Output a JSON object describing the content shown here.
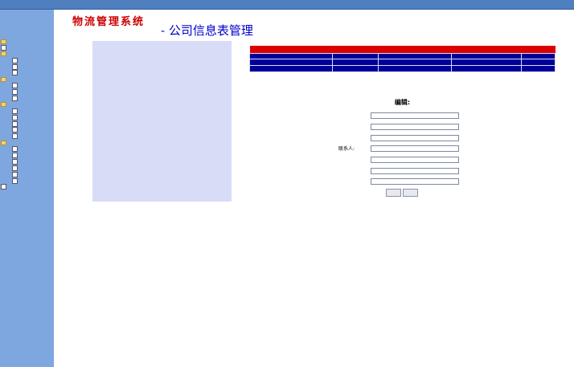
{
  "header": {
    "title": ""
  },
  "sidebar": {
    "date": "",
    "user": "",
    "items": [
      {
        "label": "",
        "level": 0,
        "icon": "folder-icon"
      },
      {
        "label": "",
        "level": 0,
        "icon": "document-icon"
      },
      {
        "label": "",
        "level": 0,
        "icon": "folder-icon"
      },
      {
        "label": "",
        "level": 1,
        "icon": "document-icon"
      },
      {
        "label": "",
        "level": 1,
        "icon": "document-icon"
      },
      {
        "label": "",
        "level": 1,
        "icon": "document-icon",
        "selected": true
      },
      {
        "label": "",
        "level": 0,
        "icon": "folder-icon"
      },
      {
        "label": "",
        "level": 1,
        "icon": "document-icon"
      },
      {
        "label": "",
        "level": 1,
        "icon": "document-icon"
      },
      {
        "label": "",
        "level": 1,
        "icon": "document-icon"
      },
      {
        "label": "",
        "level": 0,
        "icon": "folder-icon"
      },
      {
        "label": "",
        "level": 1,
        "icon": "document-icon"
      },
      {
        "label": "",
        "level": 1,
        "icon": "document-icon"
      },
      {
        "label": "",
        "level": 1,
        "icon": "document-icon"
      },
      {
        "label": "",
        "level": 1,
        "icon": "document-icon"
      },
      {
        "label": "",
        "level": 1,
        "icon": "document-icon"
      },
      {
        "label": "",
        "level": 0,
        "icon": "folder-icon"
      },
      {
        "label": "",
        "level": 1,
        "icon": "document-icon"
      },
      {
        "label": "",
        "level": 1,
        "icon": "document-icon"
      },
      {
        "label": "",
        "level": 1,
        "icon": "document-icon"
      },
      {
        "label": "",
        "level": 1,
        "icon": "document-icon"
      },
      {
        "label": "",
        "level": 1,
        "icon": "document-icon"
      },
      {
        "label": "",
        "level": 1,
        "icon": "document-icon"
      },
      {
        "label": "",
        "level": 0,
        "icon": "document-icon"
      }
    ]
  },
  "brand": "物流管理系统",
  "page_title": "- 公司信息表管理",
  "table": {
    "caption": "",
    "headers": [
      "",
      "",
      "",
      "",
      ""
    ],
    "rows": [
      [
        "",
        "",
        "",
        "",
        ""
      ],
      [
        "",
        "",
        "",
        "",
        ""
      ]
    ]
  },
  "pagination": "",
  "edit": {
    "title": "编辑:",
    "fields": [
      {
        "label": "",
        "value": "",
        "hint": ""
      },
      {
        "label": "",
        "value": "",
        "hint": ""
      },
      {
        "label": "",
        "value": "",
        "hint": ""
      },
      {
        "label": "联系人:",
        "value": "",
        "hint": ""
      },
      {
        "label": "",
        "value": "",
        "hint": ""
      },
      {
        "label": "",
        "value": "",
        "hint": ""
      },
      {
        "label": "",
        "value": "",
        "hint": ""
      }
    ],
    "submit_label": "",
    "reset_label": ""
  },
  "return_link": "",
  "footer": [
    "",
    "",
    ""
  ],
  "colors": {
    "sidebar": "#7fa7df",
    "header": "#4f7fbf",
    "table": "#000099",
    "caption": "#dd0000",
    "brand": "#cc0000",
    "title": "#0000cc"
  }
}
